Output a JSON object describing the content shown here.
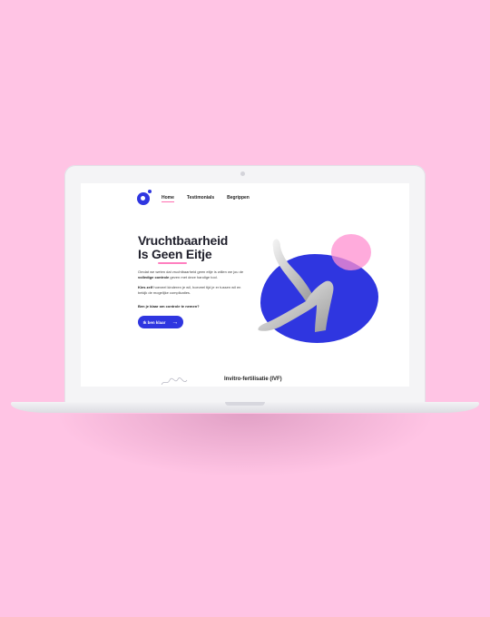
{
  "nav": {
    "items": [
      {
        "label": "Home",
        "active": true
      },
      {
        "label": "Testimonials",
        "active": false
      },
      {
        "label": "Begrippen",
        "active": false
      }
    ]
  },
  "hero": {
    "title_line1": "Vruchtbaarheid",
    "title_line2": "Is Geen Eitje",
    "p1_pre": "Omdat we weten dat vruchtbaarheid geen eitje is willen we jou de ",
    "p1_bold": "volledige controle",
    "p1_post": " geven met deze handige tool.",
    "p2_bold": "Kies zelf",
    "p2_post": " hoeveel kinderen je wil, hoeveel tijd je er tussen wil en bekijk de mogelijke complicaties.",
    "question": "Ben je klaar om controle te nemen?",
    "cta_label": "Ik ben klaar"
  },
  "section": {
    "heading": "Invitro-fertilisatie (IVF)"
  },
  "colors": {
    "background": "#ffc4e4",
    "brand_blue": "#2f36e0",
    "accent_pink": "#ff8fd0"
  },
  "icons": {
    "logo": "heart-logo-icon",
    "cta_arrow": "arrow-right-icon"
  }
}
